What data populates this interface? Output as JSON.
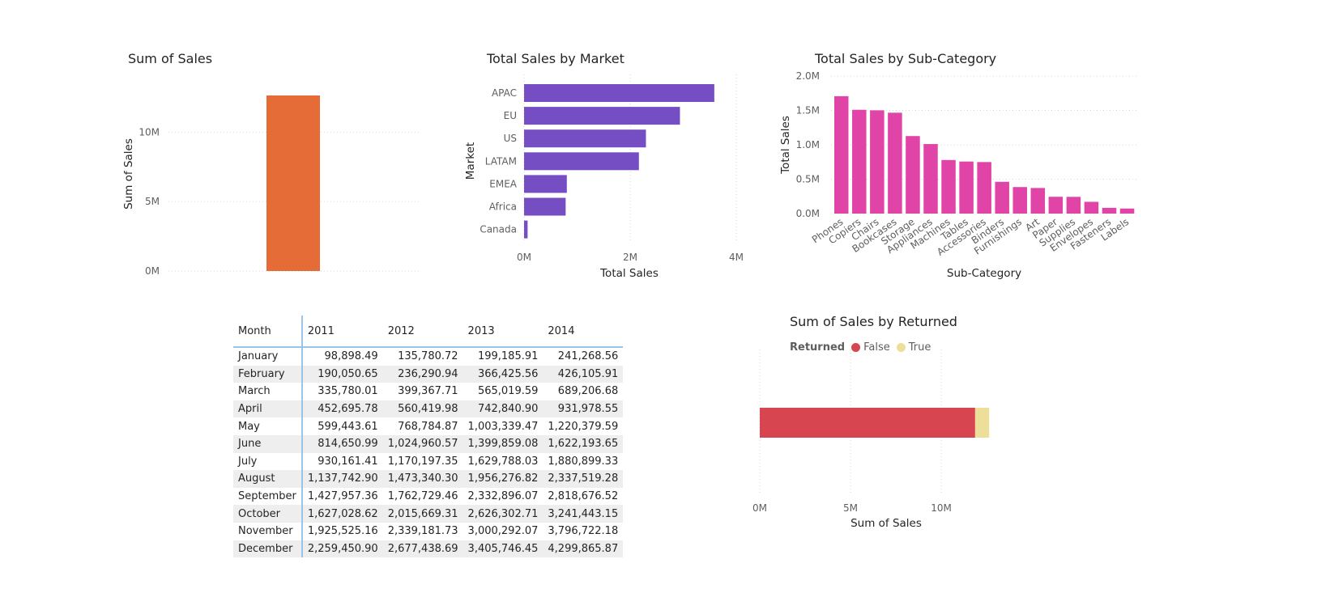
{
  "chart_data": [
    {
      "id": "sum-of-sales",
      "type": "bar",
      "title": "Sum of Sales",
      "ylabel": "Sum of Sales",
      "xlabel": "",
      "ylim": [
        0,
        12642905
      ],
      "yticks": [
        "0M",
        "5M",
        "10M"
      ],
      "ytick_values": [
        0,
        5000000,
        10000000
      ],
      "values": [
        12642905
      ],
      "grid": true,
      "colors": {
        "bar": "#E66C37"
      }
    },
    {
      "id": "sales-by-market",
      "type": "bar",
      "orientation": "horizontal",
      "title": "Total Sales by Market",
      "xlabel": "Total Sales",
      "ylabel": "Market",
      "categories": [
        "APAC",
        "EU",
        "US",
        "LATAM",
        "EMEA",
        "Africa",
        "Canada"
      ],
      "values": [
        3585745,
        2938089,
        2297201,
        2164605,
        806161,
        783773,
        66928
      ],
      "xlim": [
        0,
        4000000
      ],
      "xticks": [
        "0M",
        "2M",
        "4M"
      ],
      "xtick_values": [
        0,
        2000000,
        4000000
      ],
      "grid": true,
      "colors": {
        "bar": "#744EC2"
      }
    },
    {
      "id": "sales-by-subcategory",
      "type": "bar",
      "title": "Total Sales by Sub-Category",
      "xlabel": "Sub-Category",
      "ylabel": "Total Sales",
      "categories": [
        "Phones",
        "Copiers",
        "Chairs",
        "Bookcases",
        "Storage",
        "Appliances",
        "Machines",
        "Tables",
        "Accessories",
        "Binders",
        "Furnishings",
        "Art",
        "Paper",
        "Supplies",
        "Envelopes",
        "Fasteners",
        "Labels"
      ],
      "values": [
        1706824,
        1509436,
        1501682,
        1466572,
        1127086,
        1011064,
        779060,
        757042,
        749237,
        461912,
        385578,
        372092,
        244292,
        243082,
        170904,
        83242,
        73404
      ],
      "ylim": [
        0,
        2000000
      ],
      "yticks": [
        "0.0M",
        "0.5M",
        "1.0M",
        "1.5M",
        "2.0M"
      ],
      "ytick_values": [
        0,
        500000,
        1000000,
        1500000,
        2000000
      ],
      "grid": true,
      "colors": {
        "bar": "#E044A7"
      }
    },
    {
      "id": "sales-by-returned",
      "type": "bar",
      "orientation": "horizontal",
      "stacked": true,
      "title": "Sum of Sales by Returned",
      "xlabel": "Sum of Sales",
      "legend_title": "Returned",
      "legend_position": "top-left",
      "series": [
        {
          "name": "False",
          "values": [
            11870000
          ],
          "color": "#D64550"
        },
        {
          "name": "True",
          "values": [
            772900
          ],
          "color": "#EDDE9A"
        }
      ],
      "xlim": [
        0,
        15000000
      ],
      "xticks": [
        "0M",
        "5M",
        "10M"
      ],
      "xtick_values": [
        0,
        5000000,
        10000000
      ],
      "grid": true
    }
  ],
  "matrix": {
    "columns": [
      "Month",
      "2011",
      "2012",
      "2013",
      "2014"
    ],
    "rows": [
      [
        "January",
        "98,898.49",
        "135,780.72",
        "199,185.91",
        "241,268.56"
      ],
      [
        "February",
        "190,050.65",
        "236,290.94",
        "366,425.56",
        "426,105.91"
      ],
      [
        "March",
        "335,780.01",
        "399,367.71",
        "565,019.59",
        "689,206.68"
      ],
      [
        "April",
        "452,695.78",
        "560,419.98",
        "742,840.90",
        "931,978.55"
      ],
      [
        "May",
        "599,443.61",
        "768,784.87",
        "1,003,339.47",
        "1,220,379.59"
      ],
      [
        "June",
        "814,650.99",
        "1,024,960.57",
        "1,399,859.08",
        "1,622,193.65"
      ],
      [
        "July",
        "930,161.41",
        "1,170,197.35",
        "1,629,788.03",
        "1,880,899.33"
      ],
      [
        "August",
        "1,137,742.90",
        "1,473,340.30",
        "1,956,276.82",
        "2,337,519.28"
      ],
      [
        "September",
        "1,427,957.36",
        "1,762,729.46",
        "2,332,896.07",
        "2,818,676.52"
      ],
      [
        "October",
        "1,627,028.62",
        "2,015,669.31",
        "2,626,302.71",
        "3,241,443.15"
      ],
      [
        "November",
        "1,925,525.16",
        "2,339,181.73",
        "3,000,292.07",
        "3,796,722.18"
      ],
      [
        "December",
        "2,259,450.90",
        "2,677,438.69",
        "3,405,746.45",
        "4,299,865.87"
      ]
    ]
  }
}
